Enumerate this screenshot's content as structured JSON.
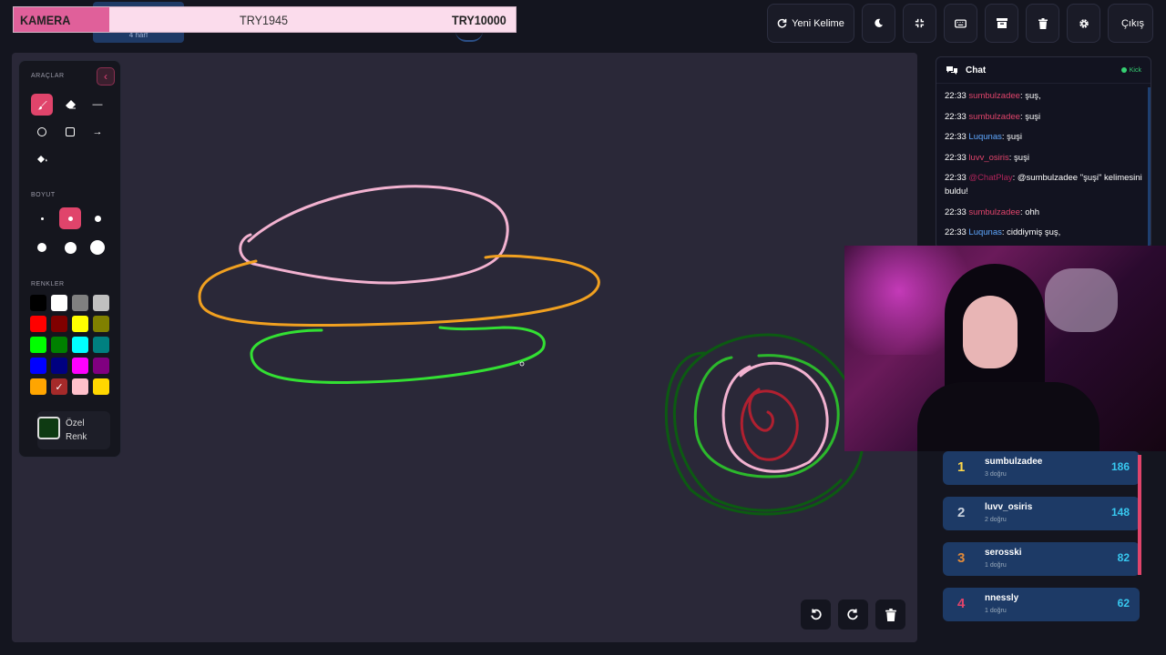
{
  "top_status": {
    "badge_text": "4 harf",
    "camera_label": "KAMERA",
    "progress_current": "TRY1945",
    "progress_goal": "TRY10000",
    "progress_fraction": 0.19
  },
  "top_actions": {
    "new_word": "Yeni Kelime",
    "logout": "Çıkış"
  },
  "tools_panel": {
    "tools_title": "ARAÇLAR",
    "size_title": "BOYUT",
    "colors_title": "RENKLER",
    "custom_color_label_1": "Özel",
    "custom_color_label_2": "Renk",
    "colors": [
      "#000000",
      "#ffffff",
      "#808080",
      "#c0c0c0",
      "#ff0000",
      "#800000",
      "#ffff00",
      "#808000",
      "#00ff00",
      "#008000",
      "#00ffff",
      "#008080",
      "#0000ff",
      "#000080",
      "#ff00ff",
      "#800080",
      "#ffa500",
      "#a52a2a",
      "#ffc0cb",
      "#ffd700"
    ],
    "selected_color": "#a52a2a",
    "custom_color": "#0e3a12"
  },
  "chat": {
    "title": "Chat",
    "platform": "Kick",
    "messages": [
      {
        "time": "22:33",
        "user": "sumbulzadee",
        "text": ": şuş,",
        "color": "#e0446b"
      },
      {
        "time": "22:33",
        "user": "sumbulzadee",
        "text": ": şuşi",
        "color": "#e0446b"
      },
      {
        "time": "22:33",
        "user": "Luqunas",
        "text": ": şuşi",
        "color": "#5fa8ff"
      },
      {
        "time": "22:33",
        "user": "luvv_osiris",
        "text": ": şuşi",
        "color": "#e0446b"
      },
      {
        "time": "22:33",
        "user": "@ChatPlay",
        "text": ": @sumbulzadee \"şuşi\" kelimesini buldu!",
        "color": "#b0245a"
      },
      {
        "time": "22:33",
        "user": "sumbulzadee",
        "text": ": ohh",
        "color": "#e0446b"
      },
      {
        "time": "22:33",
        "user": "Luqunas",
        "text": ": ciddiymiş şuş,",
        "color": "#5fa8ff"
      }
    ]
  },
  "leaderboard": [
    {
      "rank": "1",
      "name": "sumbulzadee",
      "sub": "3 doğru",
      "score": "186",
      "rank_color": "#ffd84a"
    },
    {
      "rank": "2",
      "name": "luvv_osiris",
      "sub": "2 doğru",
      "score": "148",
      "rank_color": "#c8d0dc"
    },
    {
      "rank": "3",
      "name": "serosski",
      "sub": "1 doğru",
      "score": "82",
      "rank_color": "#e08a3a"
    },
    {
      "rank": "4",
      "name": "nnessly",
      "sub": "1 doğru",
      "score": "62",
      "rank_color": "#e0446b"
    }
  ]
}
